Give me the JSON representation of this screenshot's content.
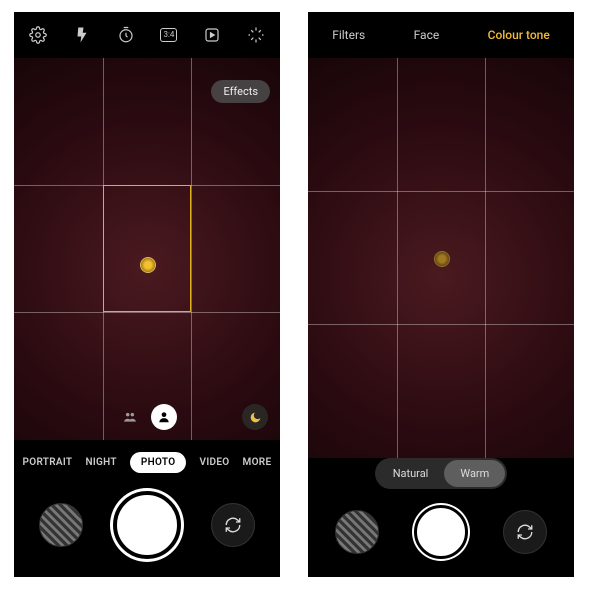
{
  "left": {
    "toolbar_icons": [
      "settings",
      "flash",
      "timer",
      "ratio",
      "motion",
      "effects"
    ],
    "ratio_label": "3:4",
    "effects_pill": "Effects",
    "subject_modes": [
      "multi",
      "single"
    ],
    "subject_selected_index": 1,
    "night_mode_indicator": true,
    "modes": [
      "PORTRAIT",
      "NIGHT",
      "PHOTO",
      "VIDEO",
      "MORE"
    ],
    "active_mode_index": 2
  },
  "right": {
    "tabs": [
      "Filters",
      "Face",
      "Colour tone"
    ],
    "active_tab_index": 2,
    "tone_options": [
      "Natural",
      "Warm"
    ],
    "active_tone_index": 1
  },
  "colors": {
    "accent": "#f2bb3a"
  }
}
